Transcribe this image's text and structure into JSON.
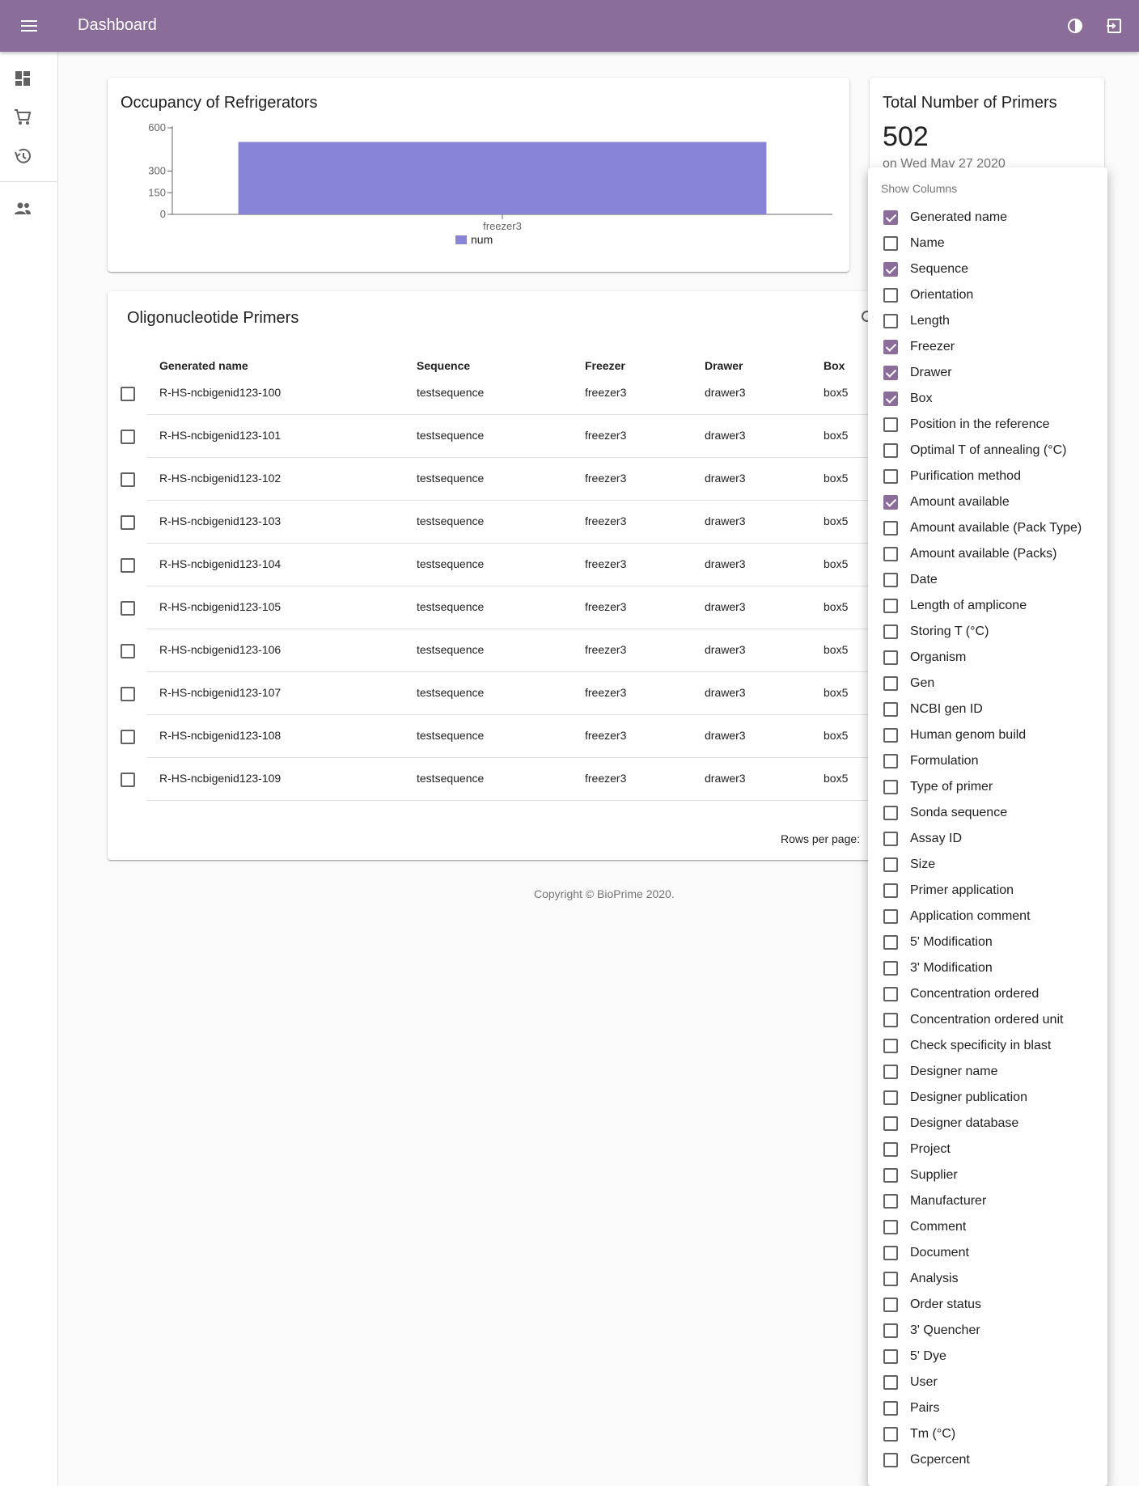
{
  "appbar": {
    "title": "Dashboard",
    "menu_icon": "menu-icon",
    "theme_icon": "contrast-icon",
    "logout_icon": "logout-icon",
    "color": "#8a6d99"
  },
  "drawer": {
    "items": [
      {
        "icon": "dashboard-icon"
      },
      {
        "icon": "cart-icon"
      },
      {
        "icon": "history-icon"
      },
      {
        "icon": "users-icon"
      }
    ]
  },
  "chart": {
    "title": "Occupancy of Refrigerators"
  },
  "chart_data": {
    "type": "bar",
    "categories": [
      "freezer3"
    ],
    "series": [
      {
        "name": "num",
        "values": [
          502
        ],
        "color": "#8884d8"
      }
    ],
    "yticks": [
      0,
      150,
      300,
      600
    ],
    "ylim": [
      0,
      600
    ],
    "legend": "bottom",
    "grid": false
  },
  "total": {
    "title": "Total Number of Primers",
    "value": "502",
    "date": "on Wed May 27 2020"
  },
  "table": {
    "title": "Oligonucleotide Primers",
    "columns": [
      "Generated name",
      "Sequence",
      "Freezer",
      "Drawer",
      "Box"
    ],
    "rows": [
      [
        "R-HS-ncbigenid123-100",
        "testsequence",
        "freezer3",
        "drawer3",
        "box5"
      ],
      [
        "R-HS-ncbigenid123-101",
        "testsequence",
        "freezer3",
        "drawer3",
        "box5"
      ],
      [
        "R-HS-ncbigenid123-102",
        "testsequence",
        "freezer3",
        "drawer3",
        "box5"
      ],
      [
        "R-HS-ncbigenid123-103",
        "testsequence",
        "freezer3",
        "drawer3",
        "box5"
      ],
      [
        "R-HS-ncbigenid123-104",
        "testsequence",
        "freezer3",
        "drawer3",
        "box5"
      ],
      [
        "R-HS-ncbigenid123-105",
        "testsequence",
        "freezer3",
        "drawer3",
        "box5"
      ],
      [
        "R-HS-ncbigenid123-106",
        "testsequence",
        "freezer3",
        "drawer3",
        "box5"
      ],
      [
        "R-HS-ncbigenid123-107",
        "testsequence",
        "freezer3",
        "drawer3",
        "box5"
      ],
      [
        "R-HS-ncbigenid123-108",
        "testsequence",
        "freezer3",
        "drawer3",
        "box5"
      ],
      [
        "R-HS-ncbigenid123-109",
        "testsequence",
        "freezer3",
        "drawer3",
        "box5"
      ]
    ],
    "rows_per_page_label": "Rows per page:"
  },
  "footer": {
    "text": "Copyright © BioPrime 2020."
  },
  "columns_menu": {
    "header": "Show Columns",
    "items": [
      {
        "label": "Generated name",
        "checked": true
      },
      {
        "label": "Name",
        "checked": false
      },
      {
        "label": "Sequence",
        "checked": true
      },
      {
        "label": "Orientation",
        "checked": false
      },
      {
        "label": "Length",
        "checked": false
      },
      {
        "label": "Freezer",
        "checked": true
      },
      {
        "label": "Drawer",
        "checked": true
      },
      {
        "label": "Box",
        "checked": true
      },
      {
        "label": "Position in the reference",
        "checked": false
      },
      {
        "label": "Optimal T of annealing (°C)",
        "checked": false
      },
      {
        "label": "Purification method",
        "checked": false
      },
      {
        "label": "Amount available",
        "checked": true
      },
      {
        "label": "Amount available (Pack Type)",
        "checked": false
      },
      {
        "label": "Amount available (Packs)",
        "checked": false
      },
      {
        "label": "Date",
        "checked": false
      },
      {
        "label": "Length of amplicone",
        "checked": false
      },
      {
        "label": "Storing T (°C)",
        "checked": false
      },
      {
        "label": "Organism",
        "checked": false
      },
      {
        "label": "Gen",
        "checked": false
      },
      {
        "label": "NCBI gen ID",
        "checked": false
      },
      {
        "label": "Human genom build",
        "checked": false
      },
      {
        "label": "Formulation",
        "checked": false
      },
      {
        "label": "Type of primer",
        "checked": false
      },
      {
        "label": "Sonda sequence",
        "checked": false
      },
      {
        "label": "Assay ID",
        "checked": false
      },
      {
        "label": "Size",
        "checked": false
      },
      {
        "label": "Primer application",
        "checked": false
      },
      {
        "label": "Application comment",
        "checked": false
      },
      {
        "label": "5' Modification",
        "checked": false
      },
      {
        "label": "3' Modification",
        "checked": false
      },
      {
        "label": "Concentration ordered",
        "checked": false
      },
      {
        "label": "Concentration ordered unit",
        "checked": false
      },
      {
        "label": "Check specificity in blast",
        "checked": false
      },
      {
        "label": "Designer name",
        "checked": false
      },
      {
        "label": "Designer publication",
        "checked": false
      },
      {
        "label": "Designer database",
        "checked": false
      },
      {
        "label": "Project",
        "checked": false
      },
      {
        "label": "Supplier",
        "checked": false
      },
      {
        "label": "Manufacturer",
        "checked": false
      },
      {
        "label": "Comment",
        "checked": false
      },
      {
        "label": "Document",
        "checked": false
      },
      {
        "label": "Analysis",
        "checked": false
      },
      {
        "label": "Order status",
        "checked": false
      },
      {
        "label": "3' Quencher",
        "checked": false
      },
      {
        "label": "5' Dye",
        "checked": false
      },
      {
        "label": "User",
        "checked": false
      },
      {
        "label": "Pairs",
        "checked": false
      },
      {
        "label": "Tm (°C)",
        "checked": false
      },
      {
        "label": "Gcpercent",
        "checked": false
      }
    ]
  }
}
